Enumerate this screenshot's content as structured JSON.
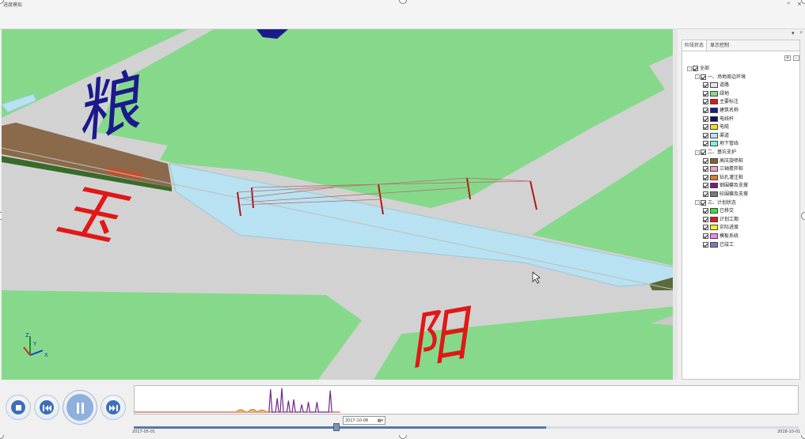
{
  "window": {
    "title": "进度模拟",
    "pin_label": "ᵖ",
    "close_label": "×",
    "menu_label": "▾",
    "pin2_label": "ᵖ"
  },
  "scene": {
    "labels": {
      "road_left": "玉",
      "road_right": "阳",
      "block_top": "粮"
    },
    "axis": {
      "x": "X",
      "y": "Y",
      "z": "Z"
    }
  },
  "panel": {
    "tabs": [
      {
        "label": "阶段状态"
      },
      {
        "label": "显示控制"
      }
    ],
    "expand_label": "+",
    "collapse_label": "-",
    "tree": [
      {
        "level": 0,
        "label": "全部",
        "expander": "⊟"
      },
      {
        "level": 1,
        "label": "一、场地周边环境",
        "expander": "⊟"
      },
      {
        "level": 2,
        "label": "道路",
        "color": "#e8e8e8"
      },
      {
        "level": 2,
        "label": "绿地",
        "color": "#86d98a"
      },
      {
        "level": 2,
        "label": "主要标注",
        "color": "#e01818"
      },
      {
        "level": 2,
        "label": "建筑名称",
        "color": "#1a1a8c"
      },
      {
        "level": 2,
        "label": "电线杆",
        "color": "#10106a"
      },
      {
        "level": 2,
        "label": "电缆",
        "color": "#f2e020"
      },
      {
        "level": 2,
        "label": "渠道",
        "color": "#b8e4f6"
      },
      {
        "level": 2,
        "label": "地下管线",
        "color": "#7ef0e6"
      },
      {
        "level": 1,
        "label": "二、基坑支护",
        "expander": "⊟"
      },
      {
        "level": 2,
        "label": "高压旋喷桩",
        "color": "#7a6a2a"
      },
      {
        "level": 2,
        "label": "三轴搅拌桩",
        "color": "#f4a0c8"
      },
      {
        "level": 2,
        "label": "钻孔灌注桩",
        "color": "#e07a2a"
      },
      {
        "level": 2,
        "label": "钢围檩及支撑",
        "color": "#7a1a8a"
      },
      {
        "level": 2,
        "label": "砼围檩及支撑",
        "color": "#7a7a7a"
      },
      {
        "level": 1,
        "label": "三、计划状态",
        "expander": "⊟"
      },
      {
        "level": 2,
        "label": "已移交",
        "color": "#3ae03a"
      },
      {
        "level": 2,
        "label": "计划工期",
        "color": "#e01818"
      },
      {
        "level": 2,
        "label": "实际进度",
        "color": "#f4f020"
      },
      {
        "level": 2,
        "label": "模板系统",
        "color": "#f088f0"
      },
      {
        "level": 2,
        "label": "已竣工",
        "color": "#7a7ab8"
      }
    ]
  },
  "timeline": {
    "current_date": "2017-10-08",
    "start_date": "2017-05-01",
    "end_date": "2018-10-01",
    "progress": 0.62,
    "playhead": 0.305
  },
  "histogram": {
    "purple_peaks": [
      {
        "t": 0.205,
        "v": 0.9
      },
      {
        "t": 0.215,
        "v": 0.55
      },
      {
        "t": 0.222,
        "v": 0.95
      },
      {
        "t": 0.232,
        "v": 0.45
      },
      {
        "t": 0.24,
        "v": 0.5
      },
      {
        "t": 0.252,
        "v": 0.3
      },
      {
        "t": 0.262,
        "v": 0.4
      },
      {
        "t": 0.275,
        "v": 0.4
      },
      {
        "t": 0.295,
        "v": 0.85
      }
    ],
    "orange_bumps": [
      {
        "t": 0.16,
        "v": 0.18
      },
      {
        "t": 0.178,
        "v": 0.2
      },
      {
        "t": 0.192,
        "v": 0.15
      }
    ]
  },
  "colors": {
    "green": "#86d98a",
    "road": "#d0d0d0",
    "water": "#b8e2f2",
    "red": "#e01818",
    "navy": "#1a1a8c",
    "accent": "#3d6fb5"
  }
}
